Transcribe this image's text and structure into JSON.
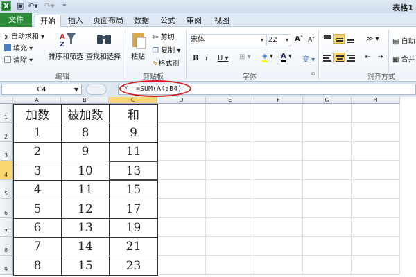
{
  "titlebar": {
    "app_icon": "X",
    "title": "表格1",
    "quick_access": [
      "save-icon",
      "undo-icon",
      "redo-icon",
      "customize-icon"
    ]
  },
  "tabs": [
    "文件",
    "开始",
    "插入",
    "页面布局",
    "数据",
    "公式",
    "审阅",
    "视图"
  ],
  "active_tab": "开始",
  "ribbon": {
    "editing": {
      "autosum": "自动求和",
      "fill": "填充",
      "clear": "清除",
      "sort_filter": "排序和筛选",
      "find_select": "查找和选择",
      "label": "编辑"
    },
    "clipboard": {
      "paste": "粘贴",
      "cut": "剪切",
      "copy": "复制",
      "format_painter": "格式刷",
      "label": "剪贴板"
    },
    "font": {
      "name": "宋体",
      "size": "22",
      "bold": "B",
      "italic": "I",
      "underline": "U",
      "font_color_glyph": "A",
      "phonetic": "变",
      "label": "字体",
      "grow": "A",
      "shrink": "A"
    },
    "alignment": {
      "label": "对齐方式",
      "wrap_short": "自动",
      "merge_short": "合并"
    }
  },
  "formula_bar": {
    "name_box": "C4",
    "fx": "fx",
    "formula": "=SUM(A4:B4)"
  },
  "columns": [
    "A",
    "B",
    "C",
    "D",
    "E",
    "F",
    "G",
    "H"
  ],
  "selected_column": "C",
  "rows": [
    "1",
    "2",
    "3",
    "4",
    "5",
    "6",
    "7",
    "8",
    "9"
  ],
  "selected_row": "4",
  "table": {
    "headers": [
      "加数",
      "被加数",
      "和"
    ],
    "rows": [
      [
        "1",
        "8",
        "9"
      ],
      [
        "2",
        "9",
        "11"
      ],
      [
        "3",
        "10",
        "13"
      ],
      [
        "4",
        "11",
        "15"
      ],
      [
        "5",
        "12",
        "17"
      ],
      [
        "6",
        "13",
        "19"
      ],
      [
        "7",
        "14",
        "21"
      ],
      [
        "8",
        "15",
        "23"
      ]
    ]
  },
  "colors": {
    "file_tab": "#2e8b3a",
    "selection": "#f9d66f",
    "annotation": "#d41a1a"
  }
}
